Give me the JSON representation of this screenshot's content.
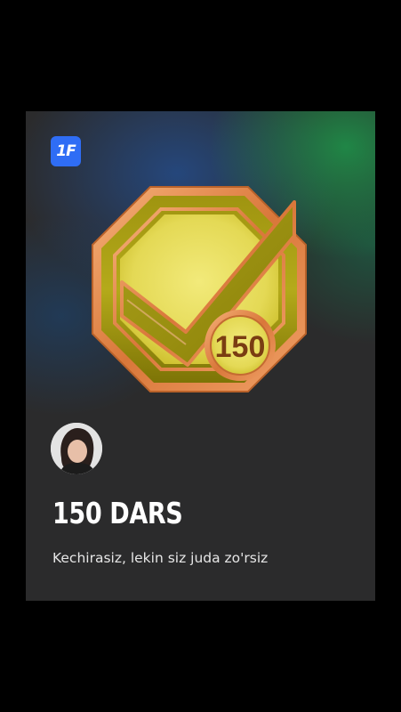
{
  "app": {
    "logo_text": "1F",
    "logo_color": "#2f6df5"
  },
  "achievement": {
    "badge_number": "150",
    "badge_icon": "checkmark-medal-icon",
    "title": "150 DARS",
    "message": "Kechirasiz, lekin siz juda zo'rsiz"
  },
  "user": {
    "avatar": "user-avatar"
  },
  "colors": {
    "background": "#000000",
    "card": "#2b2b2c",
    "badge_gold": "#c9c21a",
    "badge_copper": "#e08a4a"
  }
}
